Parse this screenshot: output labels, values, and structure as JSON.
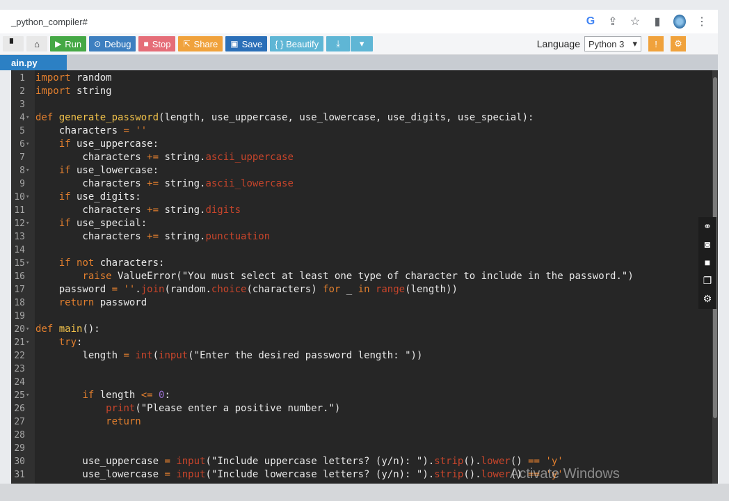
{
  "browser": {
    "url": "_python_compiler#",
    "google_icon": "G",
    "share_icon": "⇪",
    "star_icon": "☆",
    "sidepanel_icon": "▮",
    "menu_icon": "⋮"
  },
  "toolbar": {
    "icon_button_1": "▘",
    "icon_button_2": "⌂",
    "run_icon": "▶",
    "run_label": "Run",
    "debug_icon": "⊙",
    "debug_label": "Debug",
    "stop_icon": "■",
    "stop_label": "Stop",
    "share_icon": "⇱",
    "share_label": "Share",
    "save_icon": "▣",
    "save_label": "Save",
    "beautify_label": "{ } Beautify",
    "download_icon": "⤓",
    "dropdown_icon": "▾",
    "language_label": "Language",
    "language_value": "Python 3",
    "language_caret": "▾",
    "info_icon": "!",
    "settings_icon": "⚙"
  },
  "tabs": {
    "active_tab": "ain.py"
  },
  "editor": {
    "lines": [
      {
        "n": "1",
        "fold": "",
        "code": "import random"
      },
      {
        "n": "2",
        "fold": "",
        "code": "import string"
      },
      {
        "n": "3",
        "fold": "",
        "code": ""
      },
      {
        "n": "4",
        "fold": "▾",
        "code": "def generate_password(length, use_uppercase, use_lowercase, use_digits, use_special):"
      },
      {
        "n": "5",
        "fold": "",
        "code": "    characters = ''"
      },
      {
        "n": "6",
        "fold": "▾",
        "code": "    if use_uppercase:"
      },
      {
        "n": "7",
        "fold": "",
        "code": "        characters += string.ascii_uppercase"
      },
      {
        "n": "8",
        "fold": "▾",
        "code": "    if use_lowercase:"
      },
      {
        "n": "9",
        "fold": "",
        "code": "        characters += string.ascii_lowercase"
      },
      {
        "n": "10",
        "fold": "▾",
        "code": "    if use_digits:"
      },
      {
        "n": "11",
        "fold": "",
        "code": "        characters += string.digits"
      },
      {
        "n": "12",
        "fold": "▾",
        "code": "    if use_special:"
      },
      {
        "n": "13",
        "fold": "",
        "code": "        characters += string.punctuation"
      },
      {
        "n": "14",
        "fold": "",
        "code": ""
      },
      {
        "n": "15",
        "fold": "▾",
        "code": "    if not characters:"
      },
      {
        "n": "16",
        "fold": "",
        "code": "        raise ValueError(\"You must select at least one type of character to include in the password.\")"
      },
      {
        "n": "17",
        "fold": "",
        "code": "    password = ''.join(random.choice(characters) for _ in range(length))"
      },
      {
        "n": "18",
        "fold": "",
        "code": "    return password"
      },
      {
        "n": "19",
        "fold": "",
        "code": ""
      },
      {
        "n": "20",
        "fold": "▾",
        "code": "def main():"
      },
      {
        "n": "21",
        "fold": "▾",
        "code": "    try:"
      },
      {
        "n": "22",
        "fold": "",
        "code": "        length = int(input(\"Enter the desired password length: \"))"
      },
      {
        "n": "23",
        "fold": "",
        "code": ""
      },
      {
        "n": "24",
        "fold": "",
        "code": ""
      },
      {
        "n": "25",
        "fold": "▾",
        "code": "        if length <= 0:"
      },
      {
        "n": "26",
        "fold": "",
        "code": "            print(\"Please enter a positive number.\")"
      },
      {
        "n": "27",
        "fold": "",
        "code": "            return"
      },
      {
        "n": "28",
        "fold": "",
        "code": ""
      },
      {
        "n": "29",
        "fold": "",
        "code": ""
      },
      {
        "n": "30",
        "fold": "",
        "code": "        use_uppercase = input(\"Include uppercase letters? (y/n): \").strip().lower() == 'y'"
      },
      {
        "n": "31",
        "fold": "",
        "code": "        use_lowercase = input(\"Include lowercase letters? (y/n): \").strip().lower() == 'y'"
      }
    ]
  },
  "side_tools": {
    "link_icon": "⚭",
    "camera_icon": "◙",
    "video_icon": "■",
    "copy_icon": "❐",
    "gear_icon": "⚙"
  },
  "watermark": "Activate Windows"
}
